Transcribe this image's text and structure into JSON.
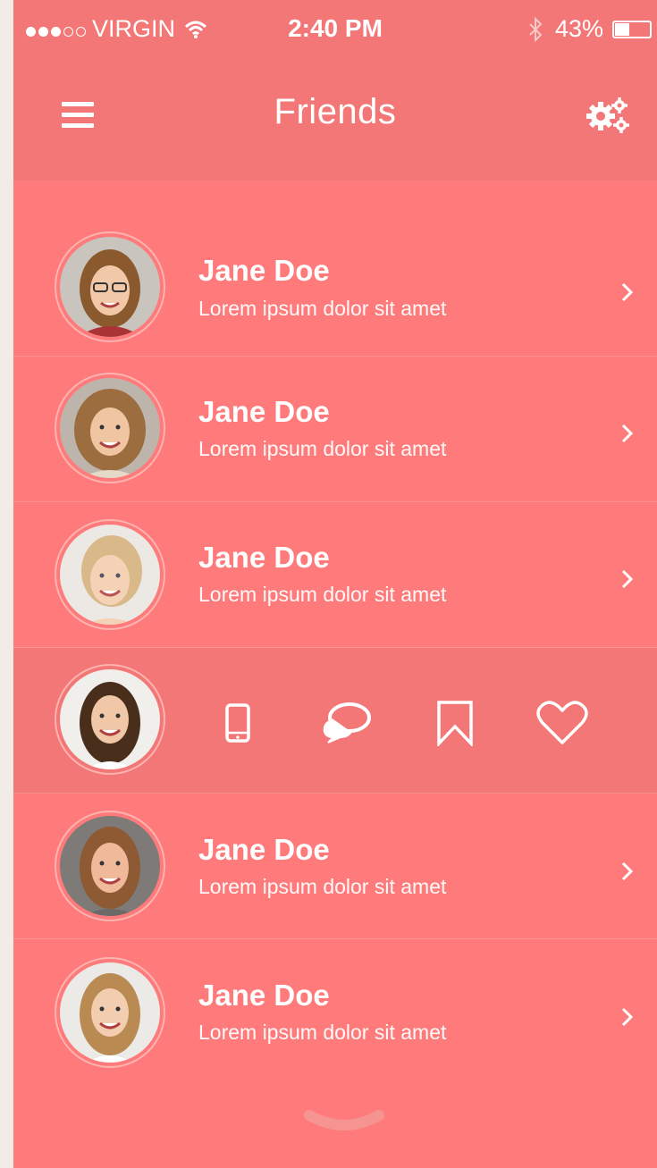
{
  "status_bar": {
    "carrier": "VIRGIN",
    "time": "2:40 PM",
    "battery": "43%",
    "battery_level": 0.43
  },
  "nav": {
    "title": "Friends",
    "menu_icon": "hamburger-icon",
    "settings_icon": "gears-icon"
  },
  "friends": [
    {
      "name": "Jane Doe",
      "subtitle": "Lorem ipsum dolor sit amet"
    },
    {
      "name": "Jane Doe",
      "subtitle": "Lorem ipsum dolor sit amet"
    },
    {
      "name": "Jane Doe",
      "subtitle": "Lorem ipsum dolor sit amet"
    },
    {
      "name": "",
      "subtitle": ""
    },
    {
      "name": "Jane Doe",
      "subtitle": "Lorem ipsum dolor sit amet"
    },
    {
      "name": "Jane Doe",
      "subtitle": "Lorem ipsum dolor sit amet"
    }
  ],
  "actions": [
    "phone-icon",
    "chat-icon",
    "bookmark-icon",
    "heart-icon"
  ],
  "colors": {
    "background": "#ff7b7b",
    "header": "#f27776",
    "active_row": "#f27776",
    "text": "#ffffff"
  }
}
